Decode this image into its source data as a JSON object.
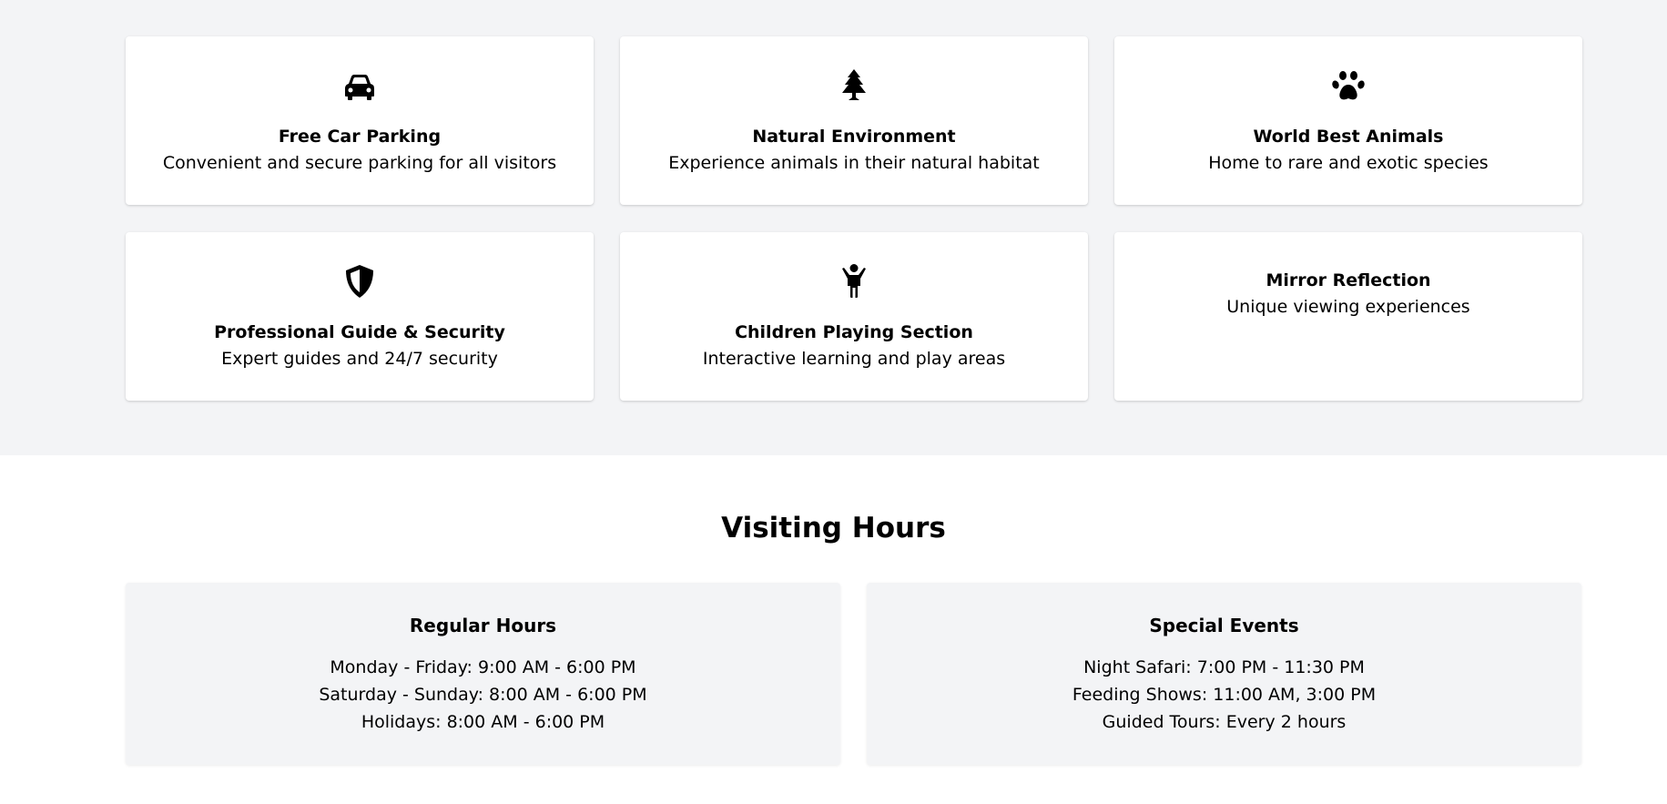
{
  "features": [
    {
      "icon": "car-icon",
      "title": "Free Car Parking",
      "description": "Convenient and secure parking for all visitors"
    },
    {
      "icon": "tree-icon",
      "title": "Natural Environment",
      "description": "Experience animals in their natural habitat"
    },
    {
      "icon": "paw-icon",
      "title": "World Best Animals",
      "description": "Home to rare and exotic species"
    },
    {
      "icon": "shield-icon",
      "title": "Professional Guide & Security",
      "description": "Expert guides and 24/7 security"
    },
    {
      "icon": "child-icon",
      "title": "Children Playing Section",
      "description": "Interactive learning and play areas"
    },
    {
      "icon": "",
      "title": "Mirror Reflection",
      "description": "Unique viewing experiences"
    }
  ],
  "visiting_hours": {
    "heading": "Visiting Hours",
    "regular": {
      "title": "Regular Hours",
      "lines": [
        "Monday - Friday: 9:00 AM - 6:00 PM",
        "Saturday - Sunday: 8:00 AM - 6:00 PM",
        "Holidays: 8:00 AM - 6:00 PM"
      ]
    },
    "special": {
      "title": "Special Events",
      "lines": [
        "Night Safari: 7:00 PM - 11:30 PM",
        "Feeding Shows: 11:00 AM, 3:00 PM",
        "Guided Tours: Every 2 hours"
      ]
    }
  },
  "colors": {
    "section_bg": "#f3f4f6",
    "card_bg": "#ffffff",
    "text": "#000000"
  }
}
